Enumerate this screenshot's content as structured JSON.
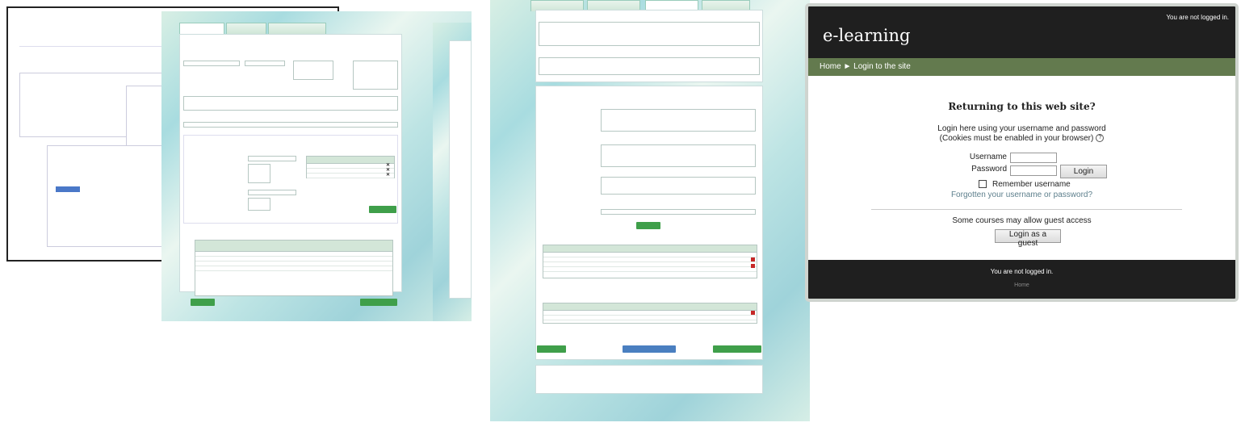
{
  "moodle": {
    "site_name": "e-learning",
    "not_logged_top": "You are not logged in.",
    "breadcrumb_home": "Home",
    "breadcrumb_sep": "►",
    "breadcrumb_current": "Login to the site",
    "heading": "Returning to this web site?",
    "intro_line1": "Login here using your username and password",
    "intro_line2": "(Cookies must be enabled in your browser)",
    "help_glyph": "?",
    "username_label": "Username",
    "username_value": "",
    "password_label": "Password",
    "password_value": "",
    "login_button": "Login",
    "remember_label": "Remember username",
    "remember_checked": false,
    "forgot_link": "Forgotten your username or password?",
    "guest_notice": "Some courses may allow guest access",
    "guest_button": "Login as a guest",
    "footer_not_logged": "You are not logged in.",
    "footer_home": "Home",
    "colors": {
      "header": "#1f1f1f",
      "nav": "#637a4e",
      "link": "#5d7f8c"
    }
  },
  "green_app": {
    "colors": {
      "button": "#3f9f4a",
      "accent": "#1f6a4a"
    },
    "icons": [
      "delete-x-icon",
      "red-remove-icon"
    ]
  }
}
